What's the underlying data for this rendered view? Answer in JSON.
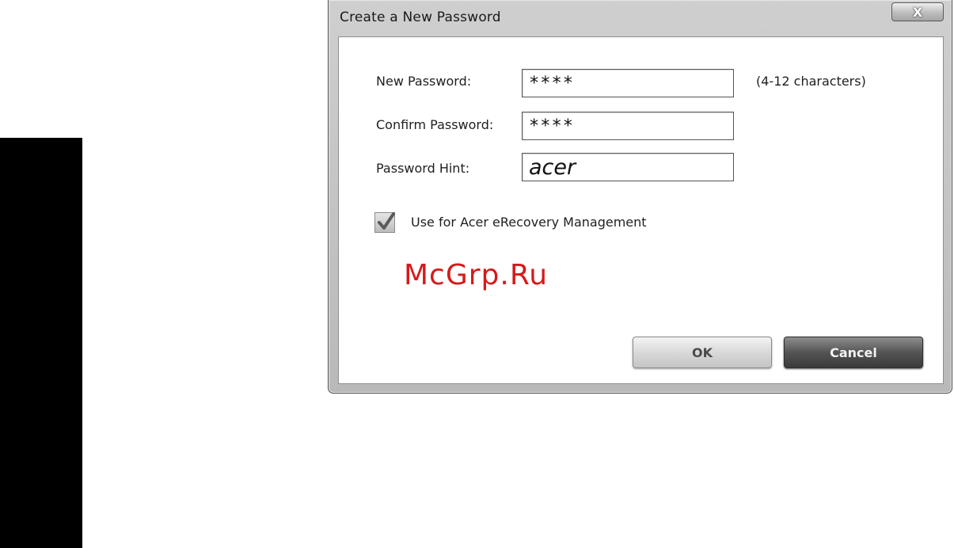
{
  "dialog": {
    "title": "Create a New Password",
    "close_label": "X"
  },
  "form": {
    "new_password": {
      "label": "New Password:",
      "value": "****",
      "hint": "(4-12 characters)"
    },
    "confirm_password": {
      "label": "Confirm Password:",
      "value": "****"
    },
    "password_hint": {
      "label": "Password Hint:",
      "value": "acer"
    },
    "erecovery": {
      "label": "Use for Acer eRecovery Management",
      "checked": true
    }
  },
  "watermark": "McGrp.Ru",
  "buttons": {
    "ok_label": "OK",
    "cancel_label": "Cancel"
  },
  "colors": {
    "watermark": "#d41a1a",
    "side_tab": "#000000"
  }
}
